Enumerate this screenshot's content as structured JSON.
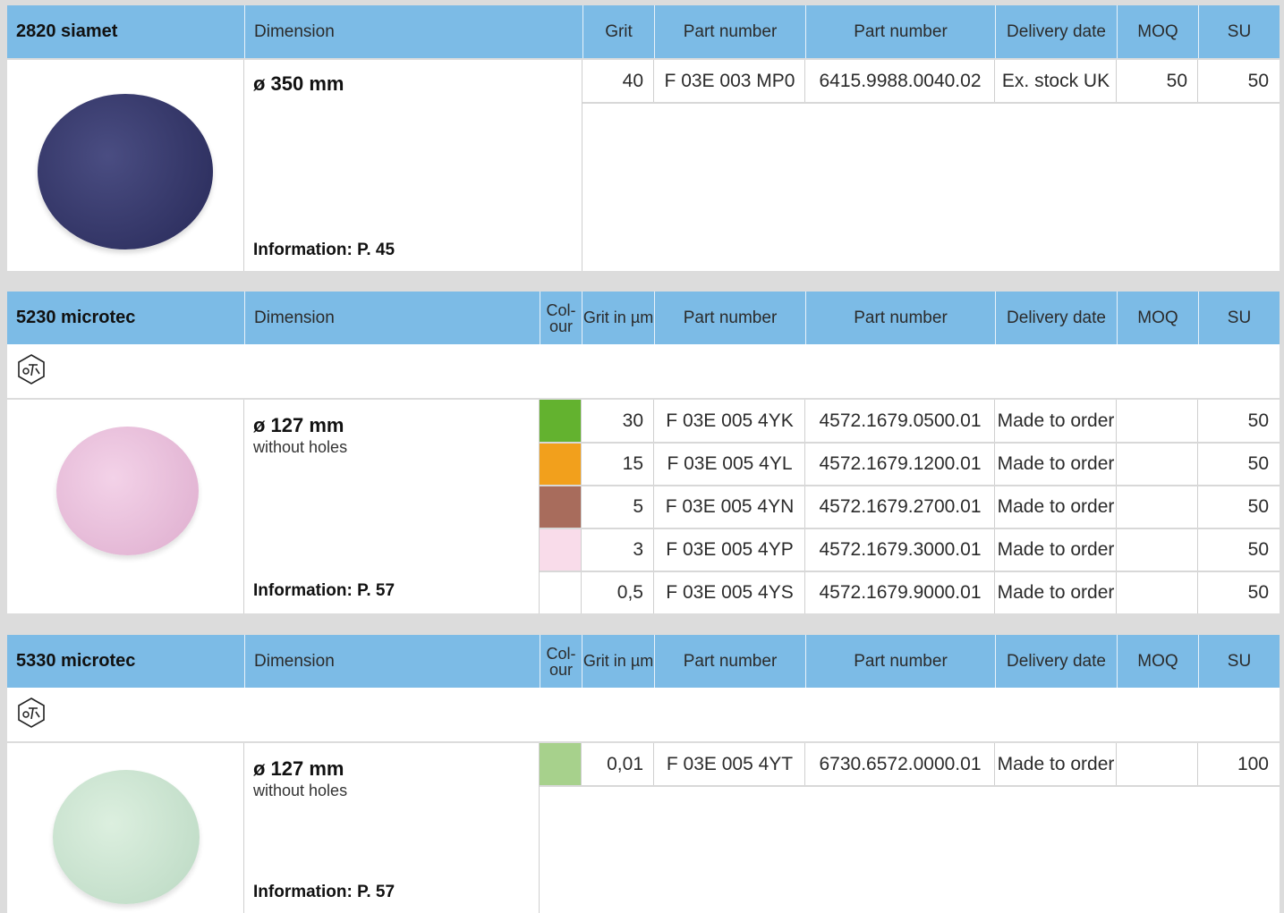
{
  "sections": [
    {
      "name": "2820 siamet",
      "headers": {
        "dimension": "Dimension",
        "grit": "Grit",
        "part1": "Part number",
        "part2": "Part number",
        "delivery": "Delivery date",
        "moq": "MOQ",
        "su": "SU"
      },
      "dimension": "ø 350 mm",
      "info": "Information: P. 45",
      "disc_color": "#3b3d6e",
      "rows": [
        {
          "grit": "40",
          "part1": "F 03E 003 MP0",
          "part2": "6415.9988.0040.02",
          "delivery": "Ex. stock UK",
          "moq": "50",
          "su": "50"
        }
      ]
    },
    {
      "name": "5230 microtec",
      "headers": {
        "dimension": "Dimension",
        "colour_a": "Col-",
        "colour_b": "our",
        "grit": "Grit in µm",
        "part1": "Part number",
        "part2": "Part number",
        "delivery": "Delivery date",
        "moq": "MOQ",
        "su": "SU"
      },
      "dimension": "ø 127 mm",
      "dimension_sub": "without holes",
      "info": "Information: P. 57",
      "disc_color": "#ecc2de",
      "rows": [
        {
          "colour": "#63b22f",
          "grit": "30",
          "part1": "F 03E 005 4YK",
          "part2": "4572.1679.0500.01",
          "delivery": "Made to order",
          "moq": "",
          "su": "50"
        },
        {
          "colour": "#f2a01c",
          "grit": "15",
          "part1": "F 03E 005 4YL",
          "part2": "4572.1679.1200.01",
          "delivery": "Made to order",
          "moq": "",
          "su": "50"
        },
        {
          "colour": "#a86c5c",
          "grit": "5",
          "part1": "F 03E 005 4YN",
          "part2": "4572.1679.2700.01",
          "delivery": "Made to order",
          "moq": "",
          "su": "50"
        },
        {
          "colour": "#f9dcea",
          "grit": "3",
          "part1": "F 03E 005 4YP",
          "part2": "4572.1679.3000.01",
          "delivery": "Made to order",
          "moq": "",
          "su": "50"
        },
        {
          "colour": "#ffffff",
          "grit": "0,5",
          "part1": "F 03E 005 4YS",
          "part2": "4572.1679.9000.01",
          "delivery": "Made to order",
          "moq": "",
          "su": "50"
        }
      ]
    },
    {
      "name": "5330 microtec",
      "headers": {
        "dimension": "Dimension",
        "colour_a": "Col-",
        "colour_b": "our",
        "grit": "Grit in µm",
        "part1": "Part number",
        "part2": "Part number",
        "delivery": "Delivery date",
        "moq": "MOQ",
        "su": "SU"
      },
      "dimension": "ø 127 mm",
      "dimension_sub": "without holes",
      "info": "Information: P. 57",
      "disc_color": "#cde6d3",
      "rows": [
        {
          "colour": "#a7d18c",
          "grit": "0,01",
          "part1": "F 03E 005 4YT",
          "part2": "6730.6572.0000.01",
          "delivery": "Made to order",
          "moq": "",
          "su": "100"
        }
      ]
    }
  ]
}
